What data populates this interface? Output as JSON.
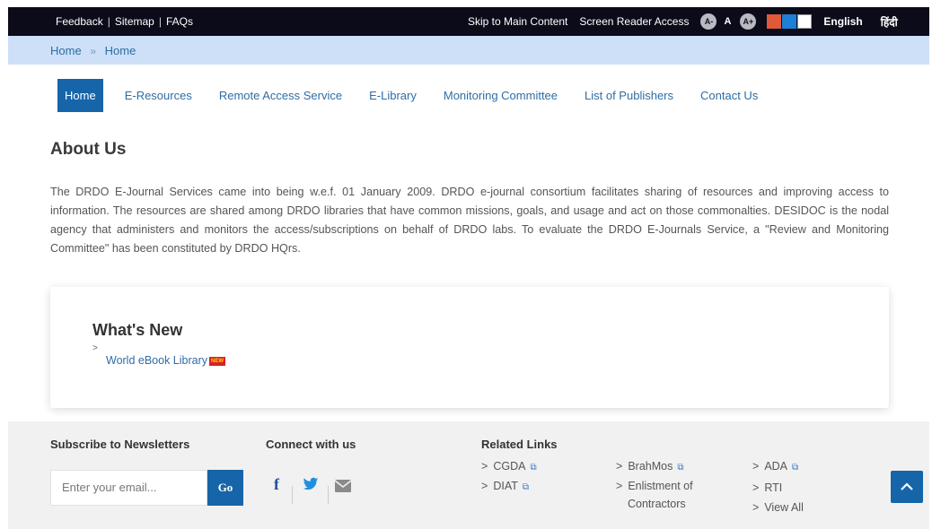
{
  "topbar": {
    "left_links": [
      "Feedback",
      "Sitemap",
      "FAQs"
    ],
    "skip_link": "Skip to Main Content",
    "screen_reader": "Screen Reader Access",
    "font_decrease": "A-",
    "font_normal": "A",
    "font_increase": "A+",
    "theme_colors": [
      "#e05a3a",
      "#1e7fd6",
      "#ffffff"
    ],
    "lang_english": "English",
    "lang_hindi": "हिंदी"
  },
  "breadcrumb": {
    "items": [
      "Home",
      "Home"
    ],
    "separator": "»"
  },
  "nav": {
    "items": [
      "Home",
      "E-Resources",
      "Remote Access Service",
      "E-Library",
      "Monitoring Committee",
      "List of Publishers",
      "Contact Us"
    ],
    "active": "Home"
  },
  "about": {
    "title": "About Us",
    "text": "The DRDO E-Journal Services came into being w.e.f. 01 January 2009. DRDO e-journal consortium facilitates sharing of resources and improving access to information. The resources are shared among DRDO libraries that have common missions, goals, and usage and act on those commonalties. DESIDOC is the nodal agency that administers and monitors the access/subscriptions on behalf of DRDO labs. To evaluate the DRDO E-Journals Service, a \"Review and Monitoring Committee\" has been constituted by DRDO HQrs."
  },
  "whats_new": {
    "title": "What's New",
    "items": [
      {
        "label": "World eBook Library",
        "badge": "NEW"
      }
    ]
  },
  "footer": {
    "subscribe_title": "Subscribe to Newsletters",
    "email_placeholder": "Enter your email...",
    "go_label": "Go",
    "connect_title": "Connect with us",
    "social_icons": [
      "facebook-icon",
      "twitter-icon",
      "email-icon"
    ],
    "related_title": "Related Links",
    "related_col1": [
      "CGDA",
      "DIAT"
    ],
    "related_col2": [
      "BrahMos",
      "Enlistment of Contractors"
    ],
    "related_col3": [
      "ADA",
      "RTI",
      "View All"
    ]
  },
  "accent_color": "#1565a8"
}
